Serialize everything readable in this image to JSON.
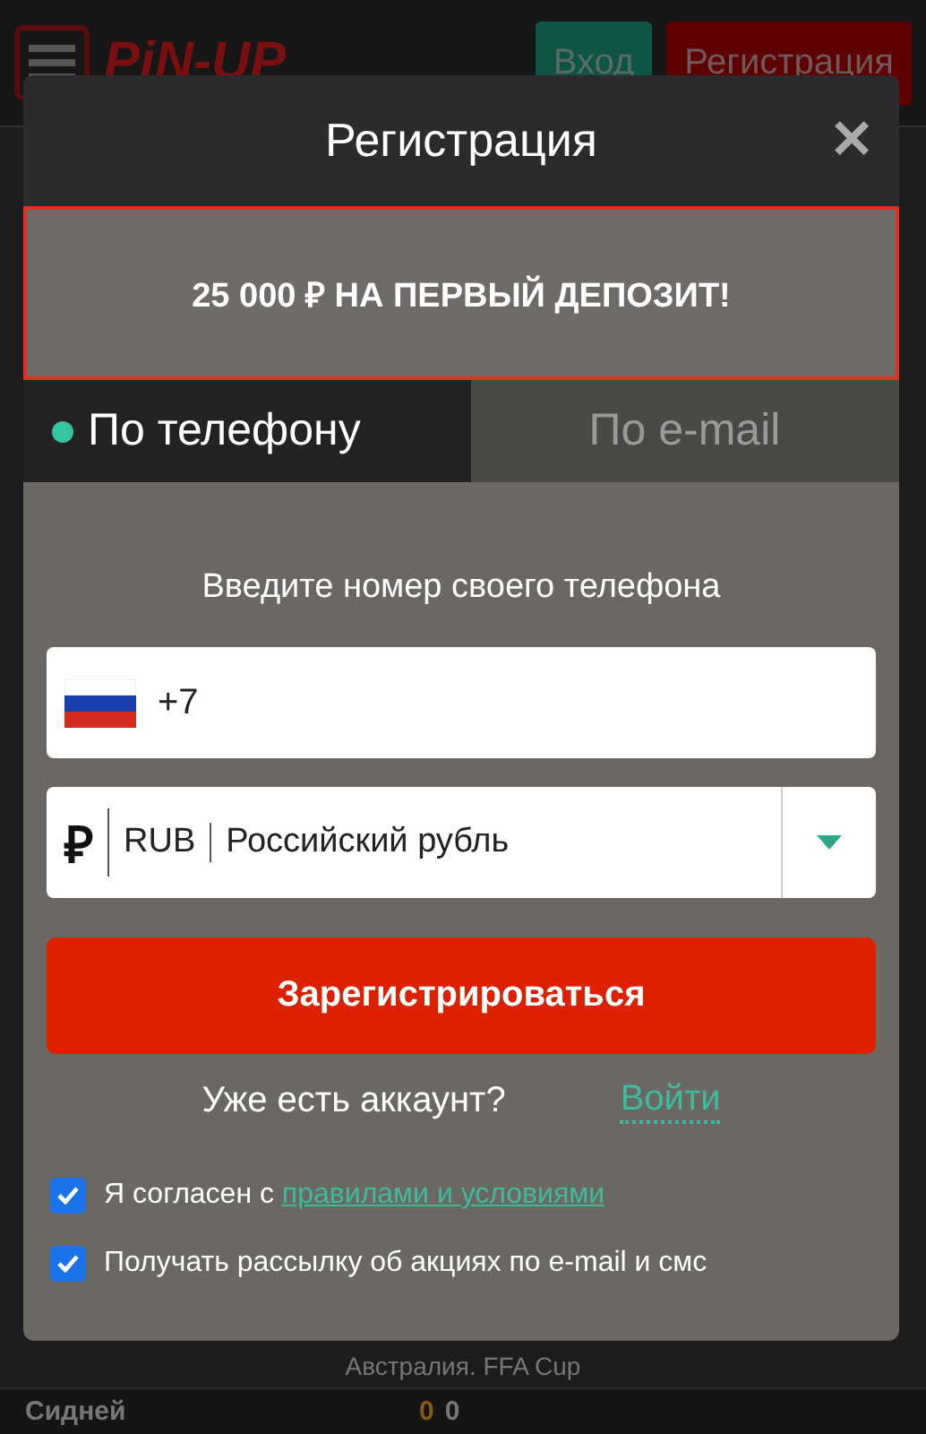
{
  "topbar": {
    "logo": "PiN-UP",
    "login_button": "Вход",
    "register_button": "Регистрация"
  },
  "background": {
    "league": "Австралия. FFA Cup",
    "team": "Сидней",
    "score_home": "0",
    "score_away": "0"
  },
  "modal": {
    "title": "Регистрация",
    "close": "✕",
    "promo": "25 000 ₽ НА ПЕРВЫЙ ДЕПОЗИТ!",
    "tabs": [
      {
        "label": "По телефону",
        "selected": true
      },
      {
        "label": "По e-mail",
        "selected": false
      }
    ],
    "prompt": "Введите номер своего телефона",
    "phone": {
      "value": "+7"
    },
    "currency": {
      "symbol": "₽",
      "code": "RUB",
      "name": "Российский рубль"
    },
    "submit": "Зарегистрироваться",
    "have_account": "Уже есть аккаунт?",
    "login_link": "Войти",
    "consents": [
      {
        "text": "Я согласен с ",
        "link": "правилами и условиями",
        "checked": true
      },
      {
        "text": "Получать рассылку об акциях по e-mail и смс",
        "checked": true
      }
    ]
  }
}
